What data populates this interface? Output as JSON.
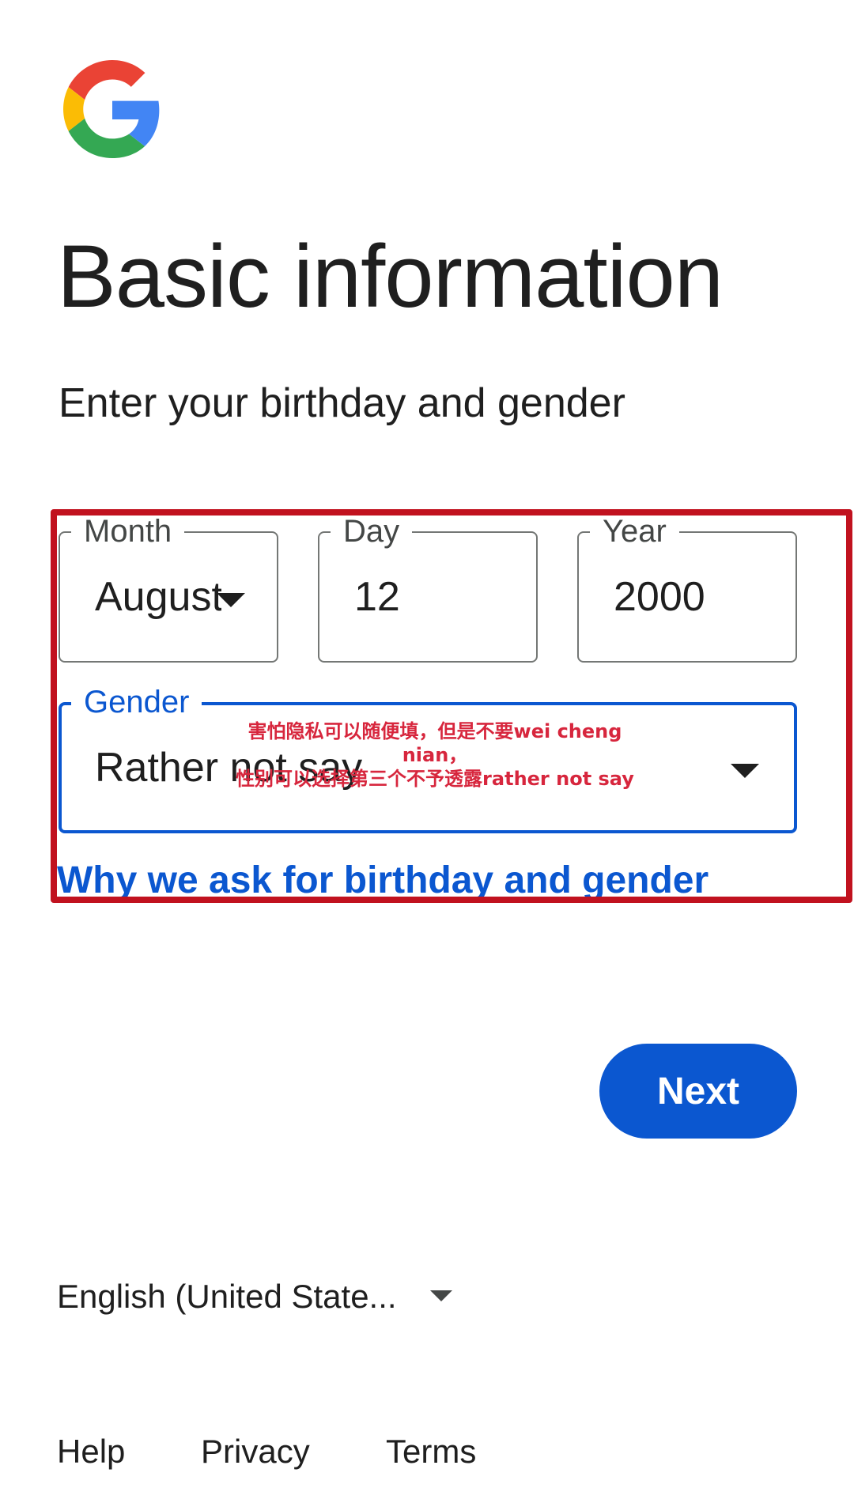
{
  "logo": {
    "name": "google-logo",
    "colors": {
      "red": "#ea4335",
      "yellow": "#fbbc04",
      "green": "#34a853",
      "blue": "#4285f4"
    }
  },
  "page": {
    "title": "Basic information",
    "subtitle": "Enter your birthday and gender"
  },
  "form": {
    "month": {
      "label": "Month",
      "value": "August"
    },
    "day": {
      "label": "Day",
      "value": "12"
    },
    "year": {
      "label": "Year",
      "value": "2000"
    },
    "gender": {
      "label": "Gender",
      "value": "Rather not say"
    },
    "why_link": "Why we ask for birthday and gender"
  },
  "annotation": {
    "line1": "害怕隐私可以随便填，但是不要wei cheng nian，",
    "line2": "性别可以选择第三个不予透露rather not say",
    "color": "#c1121f"
  },
  "actions": {
    "next_label": "Next",
    "accent": "#0b57d0"
  },
  "footer": {
    "language": "English (United State...",
    "help": "Help",
    "privacy": "Privacy",
    "terms": "Terms"
  }
}
